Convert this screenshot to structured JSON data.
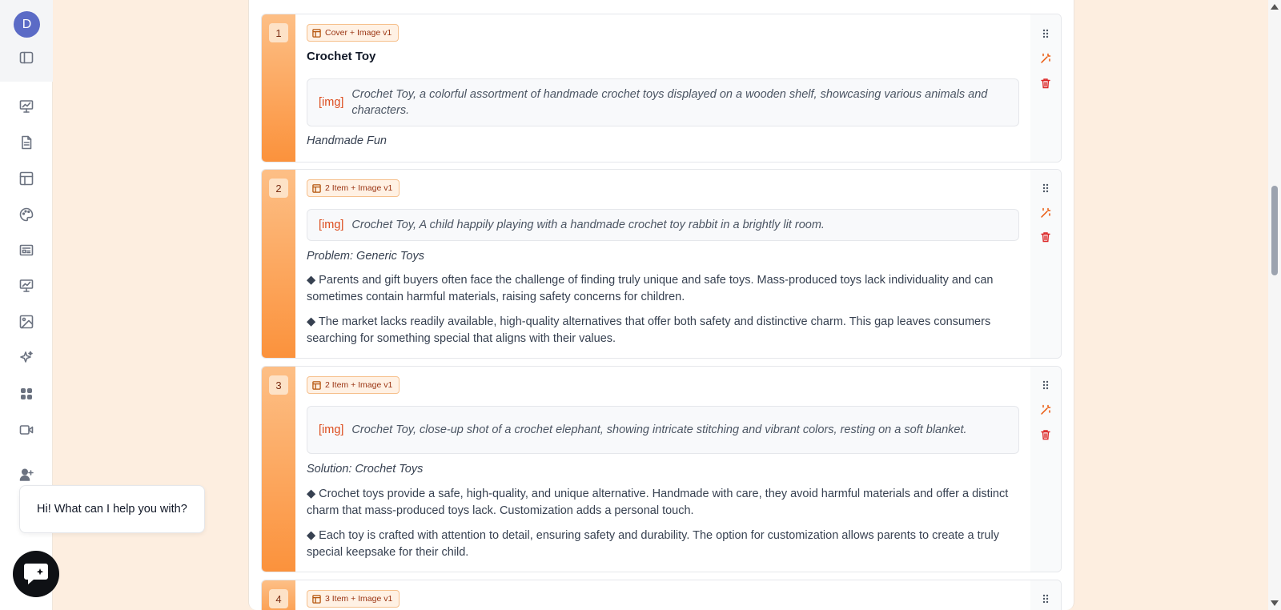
{
  "sidebar": {
    "avatar_letter": "D",
    "icons": [
      "sidebar-toggle-icon",
      "presentation-chart-icon",
      "document-icon",
      "layout-icon",
      "palette-icon",
      "slideshow-icon",
      "analytics-icon",
      "image-icon",
      "sparkles-icon",
      "apps-icon",
      "video-icon",
      "add-user-icon"
    ]
  },
  "slides": [
    {
      "number": "1",
      "layout": "Cover + Image v1",
      "title": "Crochet Toy",
      "img_tag": "[img]",
      "image_prompt": "Crochet Toy, a colorful assortment of handmade crochet toys displayed on a wooden shelf, showcasing various animals and characters.",
      "subtitle": "Handmade Fun"
    },
    {
      "number": "2",
      "layout": "2 Item + Image v1",
      "img_tag": "[img]",
      "image_prompt": "Crochet Toy, A child happily playing with a handmade crochet toy rabbit in a brightly lit room.",
      "subtitle": "Problem: Generic Toys",
      "bullets": [
        "◆ Parents and gift buyers often face the challenge of finding truly unique and safe toys. Mass-produced toys lack individuality and can sometimes contain harmful materials, raising safety concerns for children.",
        "◆ The market lacks readily available, high-quality alternatives that offer both safety and distinctive charm. This gap leaves consumers searching for something special that aligns with their values."
      ]
    },
    {
      "number": "3",
      "layout": "2 Item + Image v1",
      "img_tag": "[img]",
      "image_prompt": "Crochet Toy, close-up shot of a crochet elephant, showing intricate stitching and vibrant colors, resting on a soft blanket.",
      "subtitle": "Solution: Crochet Toys",
      "bullets": [
        "◆ Crochet toys provide a safe, high-quality, and unique alternative. Handmade with care, they avoid harmful materials and offer a distinct charm that mass-produced toys lack. Customization adds a personal touch.",
        "◆ Each toy is crafted with attention to detail, ensuring safety and durability. The option for customization allows parents to create a truly special keepsake for their child."
      ]
    },
    {
      "number": "4",
      "layout": "3 Item + Image v1"
    }
  ],
  "chat": {
    "greeting": "Hi! What can I help you with?"
  },
  "colors": {
    "accent": "#fb923c",
    "background": "#fdeee0",
    "img_tag": "#dc4b1c",
    "delete": "#dc2626",
    "avatar": "#5b6bc6"
  }
}
